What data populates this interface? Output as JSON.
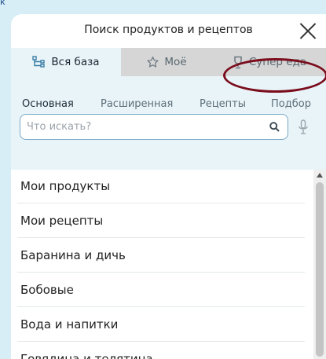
{
  "corner_text": "к",
  "dialog": {
    "title": "Поиск продуктов и рецептов",
    "close_label": "close"
  },
  "tabs": [
    {
      "label": "Вся база",
      "icon": "hierarchy-icon",
      "active": true
    },
    {
      "label": "Моё",
      "icon": "star-icon",
      "active": false
    },
    {
      "label": "Супер еда",
      "icon": "trophy-icon",
      "active": false
    }
  ],
  "subtabs": [
    {
      "label": "Основная",
      "active": true
    },
    {
      "label": "Расширенная",
      "active": false
    },
    {
      "label": "Рецепты",
      "active": false
    },
    {
      "label": "Подбор",
      "active": false
    }
  ],
  "search": {
    "value": "",
    "placeholder": "Что искать?"
  },
  "categories": [
    "Мои продукты",
    "Мои рецепты",
    "Баранина и дичь",
    "Бобовые",
    "Вода и напитки",
    "Говядина и телятина"
  ],
  "colors": {
    "annotation_circle": "#7a0c1c",
    "active_tab_bg": "#e8f4f8",
    "inactive_tab_bg": "#d6d6d6",
    "search_border": "#7aa9c8"
  }
}
